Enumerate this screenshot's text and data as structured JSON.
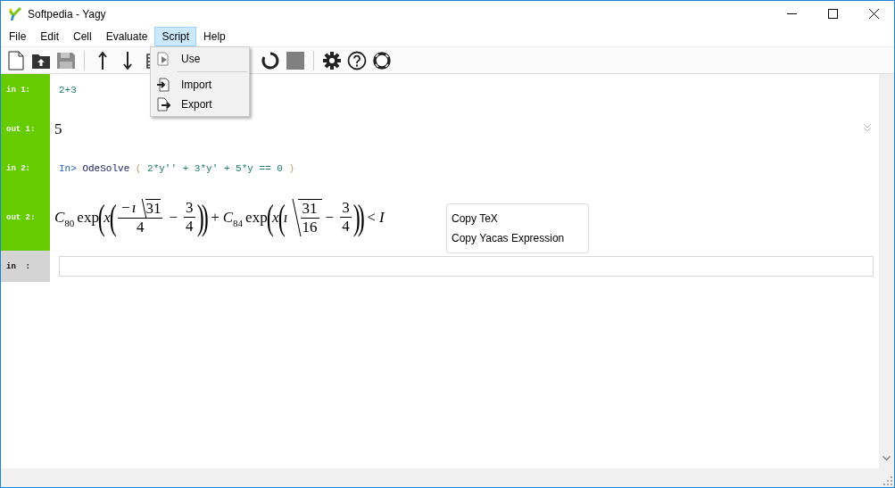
{
  "window": {
    "title": "Softpedia - Yagy"
  },
  "menu_bar": [
    {
      "label": "File",
      "selected": false
    },
    {
      "label": "Edit",
      "selected": false
    },
    {
      "label": "Cell",
      "selected": false
    },
    {
      "label": "Evaluate",
      "selected": false
    },
    {
      "label": "Script",
      "selected": true
    },
    {
      "label": "Help",
      "selected": false
    }
  ],
  "toolbar": {
    "save_disabled": true
  },
  "script_menu": [
    {
      "kind": "use",
      "label": "Use"
    },
    {
      "kind": "separator"
    },
    {
      "kind": "import",
      "label": "Import"
    },
    {
      "kind": "export",
      "label": "Export"
    }
  ],
  "cells": [
    {
      "kind": "input",
      "label": "in 1:",
      "code": [
        {
          "kind": "num",
          "text": "2+3"
        }
      ]
    },
    {
      "kind": "output",
      "label": "out 1:",
      "math": [
        {
          "kind": "num",
          "text": "5"
        }
      ],
      "collapse": true
    },
    {
      "kind": "input",
      "label": "in 2:",
      "code": [
        {
          "kind": "prompt",
          "text": "In>"
        },
        {
          "kind": "func",
          "text": "OdeSolve"
        },
        {
          "kind": "paren",
          "text": "("
        },
        {
          "kind": "num",
          "text": "2*y'' + 3*y' + 5*y == 0"
        },
        {
          "kind": "paren",
          "text": ")"
        }
      ]
    },
    {
      "kind": "output",
      "label": "out 2:",
      "math": [
        {
          "kind": "var",
          "text": "C"
        },
        {
          "kind": "sub",
          "text": "80"
        },
        {
          "kind": "fn",
          "text": "exp"
        },
        {
          "kind": "big",
          "text": "("
        },
        {
          "kind": "var",
          "text": "x"
        },
        {
          "kind": "big",
          "text": "("
        },
        {
          "kind": "frac",
          "num": [
            {
              "kind": "op",
              "text": "−"
            },
            {
              "kind": "var",
              "text": "ı"
            },
            {
              "kind": "sqrt",
              "body": [
                {
                  "kind": "num",
                  "text": "31"
                }
              ]
            }
          ],
          "den": [
            {
              "kind": "num",
              "text": "4"
            }
          ]
        },
        {
          "kind": "op",
          "text": "−"
        },
        {
          "kind": "frac",
          "num": [
            {
              "kind": "num",
              "text": "3"
            }
          ],
          "den": [
            {
              "kind": "num",
              "text": "4"
            }
          ]
        },
        {
          "kind": "big",
          "text": ")"
        },
        {
          "kind": "big",
          "text": ")"
        },
        {
          "kind": "op",
          "text": "+"
        },
        {
          "kind": "var",
          "text": "C"
        },
        {
          "kind": "sub",
          "text": "84"
        },
        {
          "kind": "fn",
          "text": "exp"
        },
        {
          "kind": "big",
          "text": "("
        },
        {
          "kind": "var",
          "text": "x"
        },
        {
          "kind": "big",
          "text": "("
        },
        {
          "kind": "var",
          "text": "ı"
        },
        {
          "kind": "sqrt",
          "body": [
            {
              "kind": "frac",
              "num": [
                {
                  "kind": "num",
                  "text": "31"
                }
              ],
              "den": [
                {
                  "kind": "num",
                  "text": "16"
                }
              ]
            }
          ]
        },
        {
          "kind": "op",
          "text": "−"
        },
        {
          "kind": "frac",
          "num": [
            {
              "kind": "num",
              "text": "3"
            }
          ],
          "den": [
            {
              "kind": "num",
              "text": "4"
            }
          ]
        },
        {
          "kind": "big",
          "text": ")"
        },
        {
          "kind": "big",
          "text": ")"
        },
        {
          "kind": "op",
          "text": "<"
        },
        {
          "kind": "var",
          "text": "I"
        }
      ]
    },
    {
      "kind": "empty",
      "label": "in  :"
    }
  ],
  "context_menu": [
    "Copy TeX",
    "Copy Yacas Expression"
  ]
}
